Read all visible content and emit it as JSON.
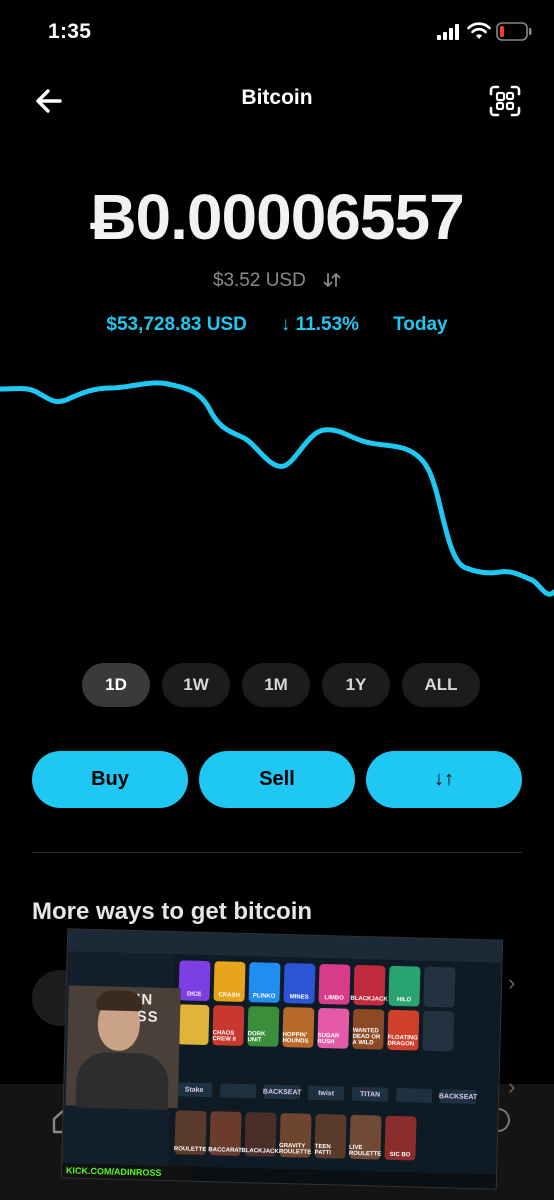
{
  "status_bar": {
    "time": "1:35"
  },
  "header": {
    "title": "Bitcoin"
  },
  "balance": {
    "btc": "Ƀ0.00006557",
    "usd": "$3.52 USD",
    "price": "$53,728.83 USD",
    "change": "↓ 11.53%",
    "period": "Today"
  },
  "ranges": [
    "1D",
    "1W",
    "1M",
    "1Y",
    "ALL"
  ],
  "actions": {
    "buy": "Buy",
    "sell": "Sell",
    "swap": "↓↑"
  },
  "section": {
    "title": "More ways to get bitcoin"
  },
  "colors": {
    "accent": "#1ec8f2",
    "background": "#000000"
  },
  "stream_overlay": {
    "kick_label": "KICK.COM/ADINROSS",
    "webcam_text": "ADIN ROSS",
    "game_tiles": [
      "DICE",
      "CRASH",
      "PLINKO",
      "MINES",
      "LIMBO",
      "BLACKJACK",
      "HILO",
      "",
      "",
      "CHAOS CREW II",
      "DORK UNIT",
      "HOPPIN' HOUNDS",
      "SUGAR RUSH",
      "WANTED DEAD OR A WILD",
      "FLOATING DRAGON",
      ""
    ],
    "providers": [
      "Stake",
      "",
      "BACKSEAT",
      "twist",
      "TITAN",
      "",
      "BACKSEAT"
    ],
    "live_tiles": [
      "ROULETTE",
      "BACCARAT",
      "BLACKJACK",
      "GRAVITY ROULETTE",
      "TEEN PATTI",
      "LIVE ROULETTE",
      "SIC BO"
    ]
  }
}
